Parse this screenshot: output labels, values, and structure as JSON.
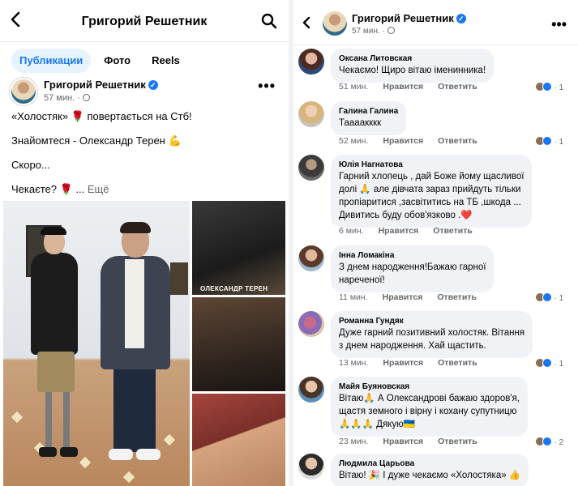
{
  "left": {
    "header": {
      "back_icon": "chevron-left-icon",
      "title": "Григорий Решетник",
      "search_icon": "search-icon"
    },
    "tabs": [
      {
        "label": "Публикации",
        "active": true
      },
      {
        "label": "Фото",
        "active": false
      },
      {
        "label": "Reels",
        "active": false
      }
    ],
    "post": {
      "author": "Григорий Решетник",
      "verified": "✓",
      "time": "57 мин. ·",
      "lines": [
        "«Холостяк» 🌹 повертається на Стб!",
        "Знайомтеся - Олександр Терен 💪",
        "Скоро...",
        "Чекаєте? 🌹 ..."
      ],
      "see_more": "Ещё",
      "photo_caption": "ОЛЕКСАНДР ТЕРЕН"
    }
  },
  "right": {
    "header": {
      "back_icon": "chevron-left-icon",
      "name": "Григорий Решетник",
      "verified": "✓",
      "time": "57 мин. ·",
      "more_icon": "more-dots-icon"
    },
    "actions": {
      "like": "Нравится",
      "reply": "Ответить"
    },
    "comments": [
      {
        "author": "Оксана Литовская",
        "lines": [
          "Чекаємо! Щиро вітаю іменинника!"
        ],
        "time": "51 мин.",
        "reactions": "1"
      },
      {
        "author": "Галина Галина",
        "lines": [
          "Таааакккк"
        ],
        "time": "52 мин.",
        "reactions": "1"
      },
      {
        "author": "Юлія Нагнатова",
        "lines": [
          "Гарний хлопець , дай Боже йому щасливої",
          "долі 🙏 але дівчата зараз прийдуть тільки",
          "пропіаритися ,засвітитись на ТБ ,шкода ...",
          "Дивитись буду обов'язково .❤️"
        ],
        "time": "6 мин.",
        "reactions": ""
      },
      {
        "author": "Інна Ломакіна",
        "lines": [
          "З днем народження!Бажаю гарної",
          "нареченої!"
        ],
        "time": "11 мин.",
        "reactions": "1"
      },
      {
        "author": "Романна Гундяк",
        "lines": [
          "Дуже гарний позитивний холостяк. Вітання",
          "з днем народження. Хай щастить."
        ],
        "time": "13 мин.",
        "reactions": "1"
      },
      {
        "author": "Майя Буяновская",
        "lines": [
          "Вітаю🙏 А Олександрові бажаю здоров'я,",
          "щастя земного і вірну і кохану супутницю",
          "🙏🙏🙏 Дякую🇺🇦"
        ],
        "time": "23 мин.",
        "reactions": "2"
      },
      {
        "author": "Людмила Царьова",
        "lines": [
          "Вітаю! 🎉 І дуже чекаємо «Холостяка» 👍"
        ],
        "time": "",
        "reactions": ""
      }
    ]
  }
}
